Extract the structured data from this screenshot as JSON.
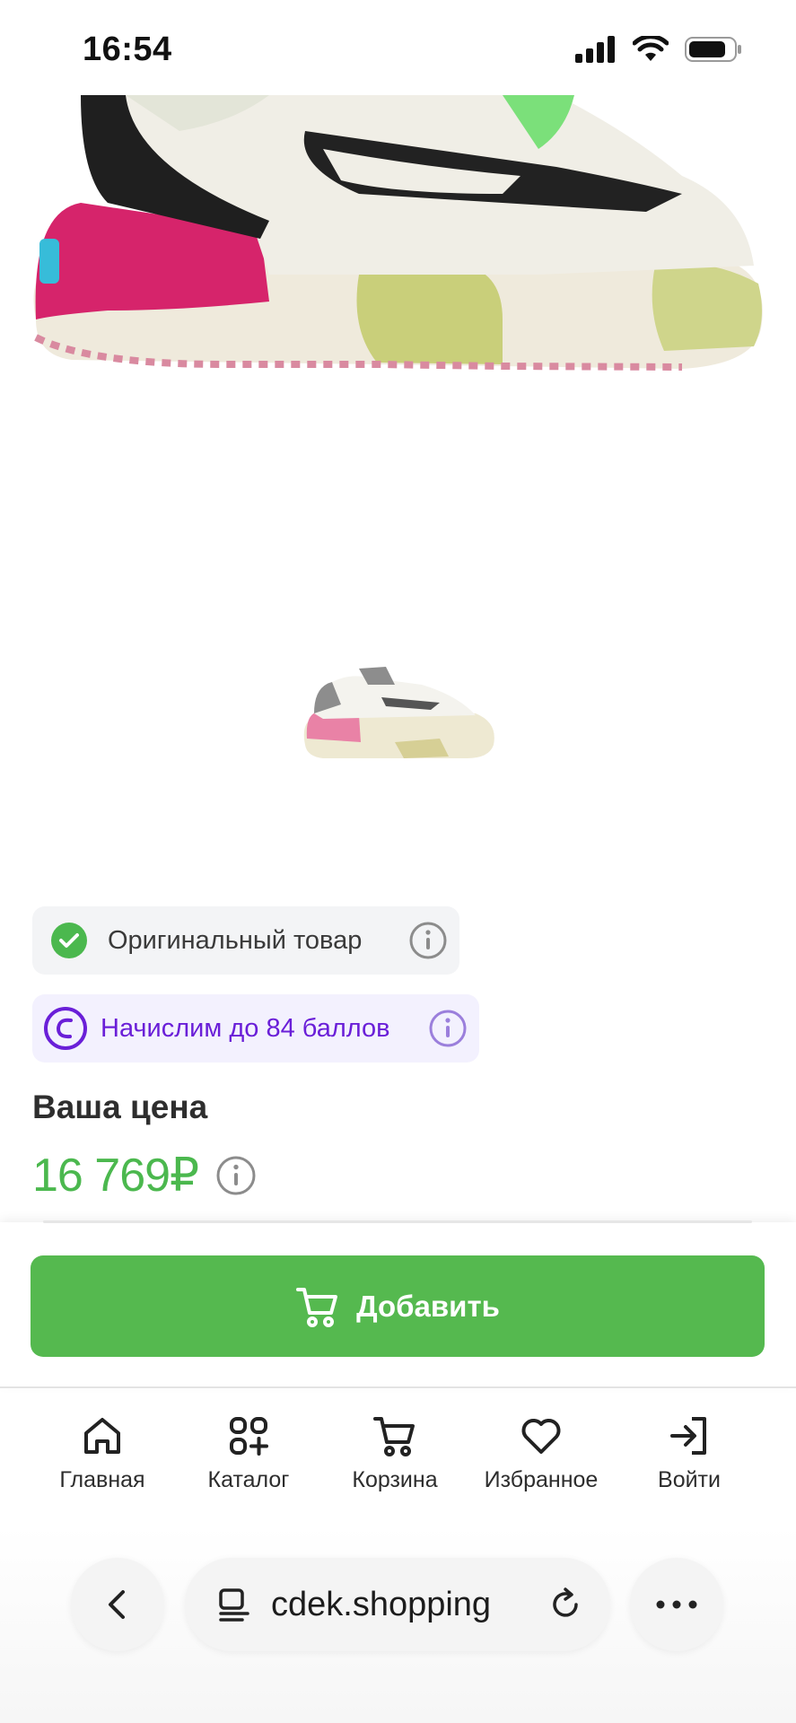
{
  "status": {
    "time": "16:54"
  },
  "badges": {
    "original": "Оригинальный товар",
    "bonus": "Начислим до 84 баллов"
  },
  "price": {
    "label": "Ваша цена",
    "value": "16 769₽"
  },
  "cart": {
    "add_label": "Добавить"
  },
  "tabs": [
    {
      "label": "Главная",
      "icon": "home-icon"
    },
    {
      "label": "Каталог",
      "icon": "catalog-icon"
    },
    {
      "label": "Корзина",
      "icon": "cart-icon"
    },
    {
      "label": "Избранное",
      "icon": "heart-icon"
    },
    {
      "label": "Войти",
      "icon": "login-icon"
    }
  ],
  "browser": {
    "url": "cdek.shopping"
  },
  "colors": {
    "accent": "#55b94f",
    "price": "#4bb84e",
    "bonus": "#6a1fd8"
  }
}
